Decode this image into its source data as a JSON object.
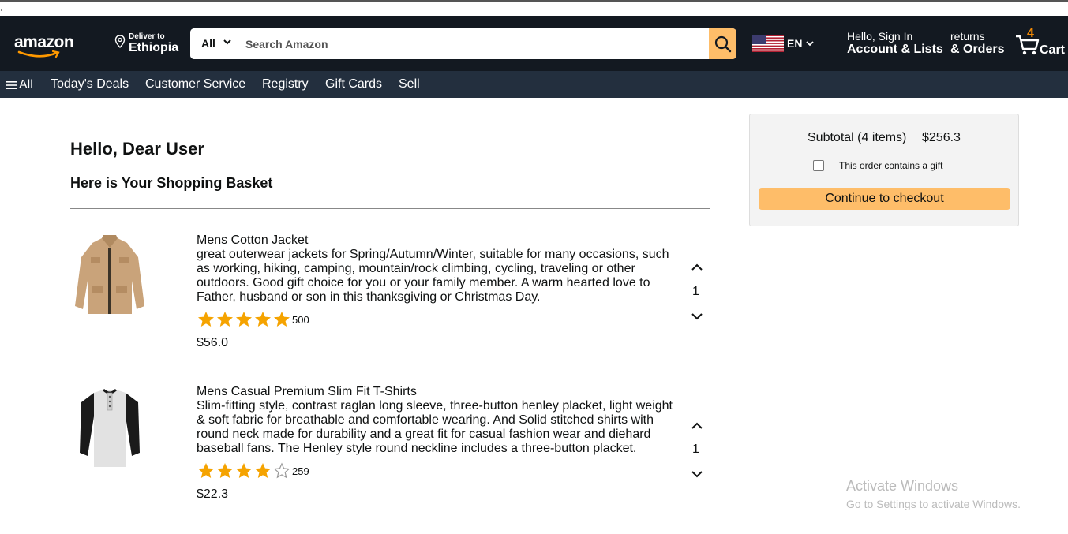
{
  "header": {
    "logo_text": "amazon",
    "deliver_to_label": "Deliver to",
    "deliver_to_location": "Ethiopia",
    "search_category": "All",
    "search_placeholder": "Search Amazon",
    "language": "EN",
    "account_greeting": "Hello, Sign In",
    "account_label": "Account & Lists",
    "returns_label": "returns",
    "orders_label": "& Orders",
    "cart_count": "4",
    "cart_label": "Cart"
  },
  "nav": {
    "all_label": "All",
    "items": [
      "Today's Deals",
      "Customer Service",
      "Registry",
      "Gift Cards",
      "Sell"
    ]
  },
  "main": {
    "greeting": "Hello, Dear User",
    "basket_title": "Here is Your Shopping Basket",
    "products": [
      {
        "title": "Mens Cotton Jacket",
        "description": "great outerwear jackets for Spring/Autumn/Winter, suitable for many occasions, such as working, hiking, camping, mountain/rock climbing, cycling, traveling or other outdoors. Good gift choice for you or your family member. A warm hearted love to Father, husband or son in this thanksgiving or Christmas Day.",
        "rating": 4.7,
        "rating_count": "500",
        "price": "$56.0",
        "quantity": "1"
      },
      {
        "title": "Mens Casual Premium Slim Fit T-Shirts",
        "description": "Slim-fitting style, contrast raglan long sleeve, three-button henley placket, light weight & soft fabric for breathable and comfortable wearing. And Solid stitched shirts with round neck made for durability and a great fit for casual fashion wear and diehard baseball fans. The Henley style round neckline includes a three-button placket.",
        "rating": 4.1,
        "rating_count": "259",
        "price": "$22.3",
        "quantity": "1"
      }
    ]
  },
  "subtotal": {
    "label": "Subtotal (4 items)",
    "amount": "$256.3",
    "gift_label": "This order contains a gift",
    "gift_checked": false,
    "checkout_label": "Continue to checkout"
  },
  "watermark": {
    "line1": "Activate Windows",
    "line2": "Go to Settings to activate Windows."
  },
  "colors": {
    "header_bg": "#131921",
    "nav_bg": "#232f3e",
    "accent": "#febd69",
    "star": "#f5a300"
  }
}
